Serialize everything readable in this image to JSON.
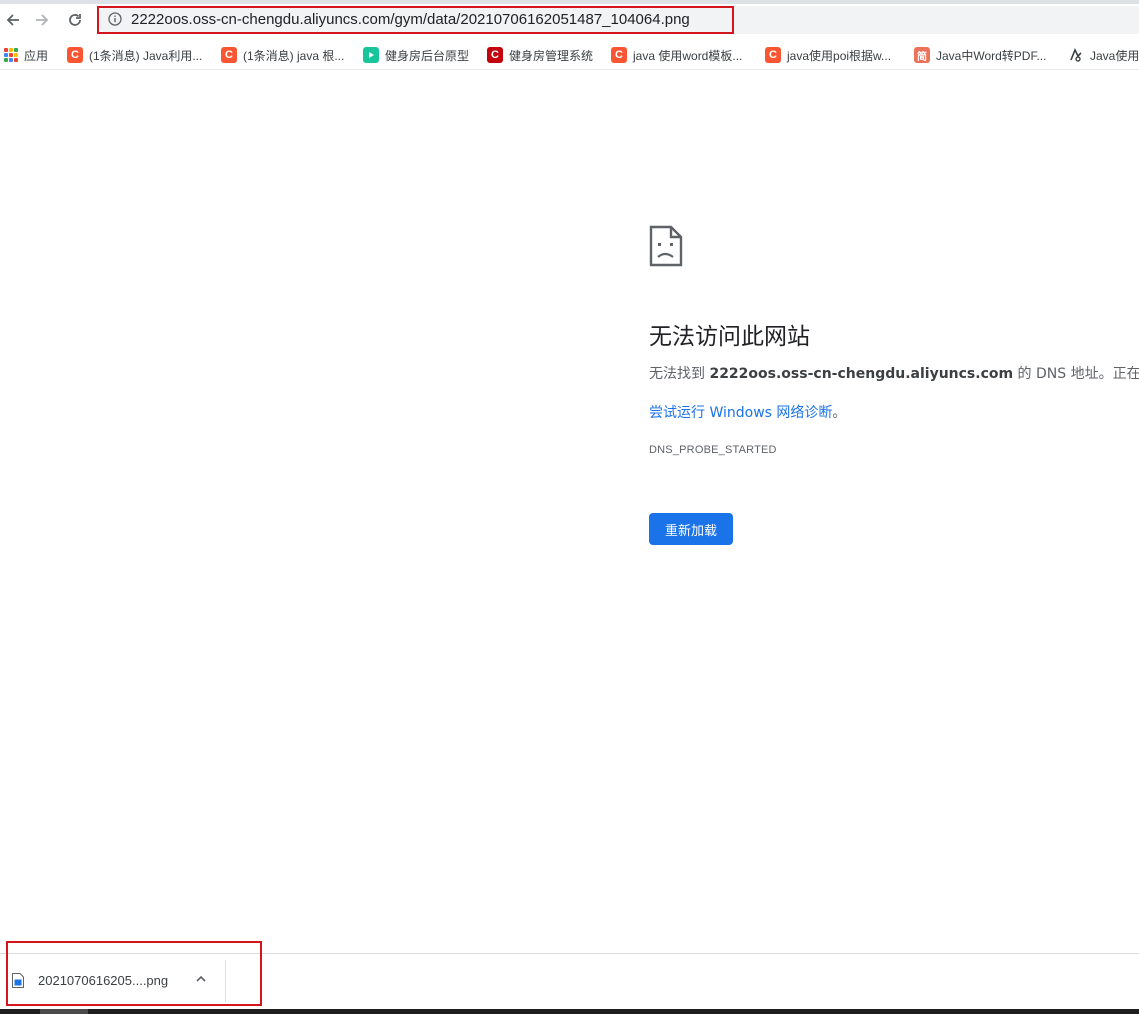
{
  "browser": {
    "url": "2222oos.oss-cn-chengdu.aliyuncs.com/gym/data/20210706162051487_104064.png"
  },
  "bookmarks": [
    {
      "label": "应用",
      "icon": "apps-grid-icon"
    },
    {
      "label": "(1条消息) Java利用...",
      "icon": "csdn-icon"
    },
    {
      "label": "(1条消息) java 根...",
      "icon": "csdn-icon"
    },
    {
      "label": "健身房后台原型",
      "icon": "play-icon"
    },
    {
      "label": "健身房管理系统",
      "icon": "c-logo-icon"
    },
    {
      "label": "java 使用word模板...",
      "icon": "csdn-icon"
    },
    {
      "label": "java使用poi根据w...",
      "icon": "csdn-icon"
    },
    {
      "label": "Java中Word转PDF...",
      "icon": "jianshu-icon"
    },
    {
      "label": "Java使用",
      "icon": "bookmark-icon"
    }
  ],
  "error_page": {
    "title": "无法访问此网站",
    "desc_prefix": "无法找到 ",
    "desc_host": "2222oos.oss-cn-chengdu.aliyuncs.com",
    "desc_suffix": " 的 DNS 地址。正在诊断",
    "diag_link": "尝试运行 Windows 网络诊断",
    "diag_suffix": "。",
    "error_code": "DNS_PROBE_STARTED",
    "reload_label": "重新加载"
  },
  "downloads": {
    "item_name": "2021070616205....png"
  },
  "colors": {
    "accent": "#1a73e8",
    "highlight_box": "#d4151b"
  }
}
